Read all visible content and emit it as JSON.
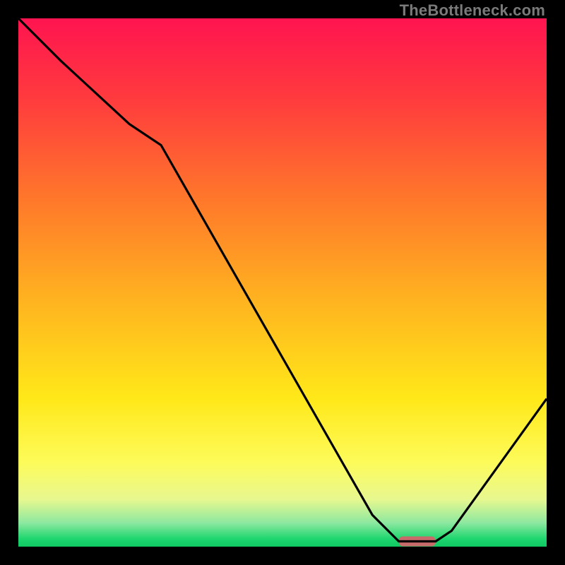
{
  "watermark": "TheBottleneck.com",
  "chart_data": {
    "type": "line",
    "title": "",
    "xlabel": "",
    "ylabel": "",
    "xlim": [
      0,
      100
    ],
    "ylim": [
      0,
      100
    ],
    "grid": false,
    "series": [
      {
        "name": "curve",
        "x": [
          0,
          8,
          21,
          27,
          67,
          72,
          79,
          82,
          100
        ],
        "values": [
          100,
          92,
          80,
          76,
          6,
          1,
          1,
          3,
          28
        ]
      }
    ],
    "marker": {
      "x_start": 72,
      "x_end": 79,
      "y": 1,
      "color": "#c96a6a"
    },
    "gradient_stops": [
      {
        "offset": 0.0,
        "color": "#ff1450"
      },
      {
        "offset": 0.15,
        "color": "#ff3a3e"
      },
      {
        "offset": 0.35,
        "color": "#ff7a2a"
      },
      {
        "offset": 0.55,
        "color": "#ffb81f"
      },
      {
        "offset": 0.72,
        "color": "#ffe819"
      },
      {
        "offset": 0.84,
        "color": "#fdfb5a"
      },
      {
        "offset": 0.91,
        "color": "#e8f88f"
      },
      {
        "offset": 0.955,
        "color": "#8de8a0"
      },
      {
        "offset": 0.985,
        "color": "#1fd66f"
      },
      {
        "offset": 1.0,
        "color": "#0fc963"
      }
    ]
  }
}
